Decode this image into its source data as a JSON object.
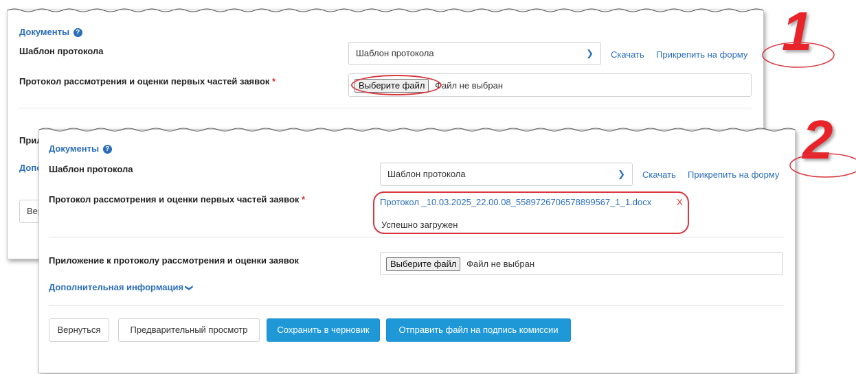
{
  "panel1": {
    "section_title": "Документы",
    "template_label": "Шаблон протокола",
    "template_select_value": "Шаблон протокола",
    "download_link": "Скачать",
    "attach_link": "Прикрепить на форму",
    "protocol_label": "Протокол рассмотрения и оценки первых частей заявок",
    "required_mark": "*",
    "file_button": "Выберите файл",
    "file_status": "Файл не выбран",
    "partial_labels": [
      "Прил",
      "Допо",
      "Вер"
    ]
  },
  "panel2": {
    "section_title": "Документы",
    "template_label": "Шаблон протокола",
    "template_select_value": "Шаблон протокола",
    "download_link": "Скачать",
    "attach_link": "Прикрепить на форму",
    "protocol_label": "Протокол рассмотрения и оценки первых частей заявок",
    "required_mark": "*",
    "uploaded_file_name": "Протокол _10.03.2025_22.00.08_5589726706578899567_1_1.docx",
    "remove_mark": "X",
    "upload_status": "Успешно загружен",
    "appendix_label": "Приложение к протоколу рассмотрения и оценки заявок",
    "appendix_file_button": "Выберите файл",
    "appendix_file_status": "Файл не выбран",
    "additional_info": "Дополнительная информация",
    "buttons": {
      "back": "Вернуться",
      "preview": "Предварительный просмотр",
      "save_draft": "Сохранить в черновик",
      "send_sign": "Отправить файл на подпись комиссии"
    }
  },
  "callouts": {
    "one": "1",
    "two": "2"
  },
  "colors": {
    "link": "#2a6ebb",
    "primary": "#1e98d7",
    "required": "#d32f2f",
    "annotation": "#e8232a"
  }
}
